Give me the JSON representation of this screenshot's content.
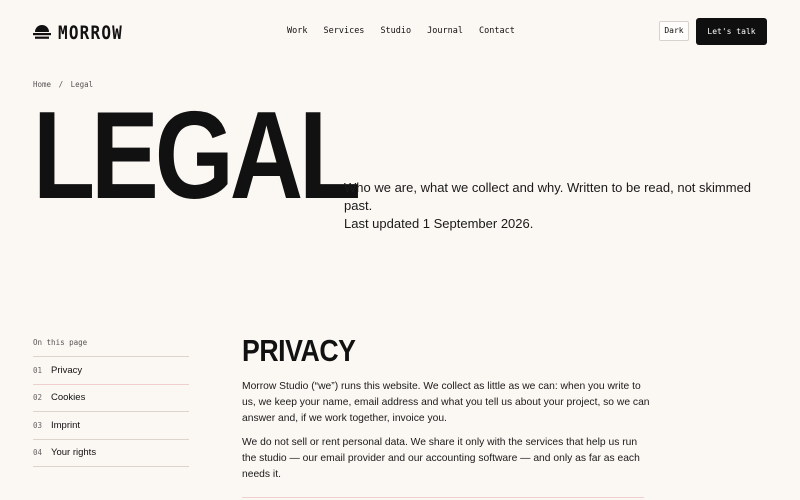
{
  "header": {
    "brand": "MORROW",
    "nav": [
      "Work",
      "Services",
      "Studio",
      "Journal",
      "Contact"
    ],
    "theme_toggle_label": "Dark",
    "cta_label": "Let's talk"
  },
  "breadcrumb": {
    "home": "Home",
    "separator": "/",
    "current": "Legal"
  },
  "hero": {
    "title": "LEGAL",
    "intro_line1": "Who we are, what we collect and why. Written to be read, not skimmed past.",
    "intro_line2": "Last updated 1 September 2026."
  },
  "toc": {
    "label": "On this page",
    "items": [
      {
        "num": "01",
        "label": "Privacy"
      },
      {
        "num": "02",
        "label": "Cookies"
      },
      {
        "num": "03",
        "label": "Imprint"
      },
      {
        "num": "04",
        "label": "Your rights"
      }
    ]
  },
  "privacy": {
    "title": "PRIVACY",
    "paragraph1": "Morrow Studio (“we”) runs this website. We collect as little as we can: when you write to us, we keep your name, email address and what you tell us about your project, so we can answer and, if we work together, invoice you.",
    "paragraph2": "We do not sell or rent personal data. We share it only with the services that help us run the studio — our email provider and our accounting software — and only as far as each needs it."
  },
  "colors": {
    "background": "#fbf7f3",
    "text": "#111111",
    "accent_rule": "#f0cfcf"
  }
}
